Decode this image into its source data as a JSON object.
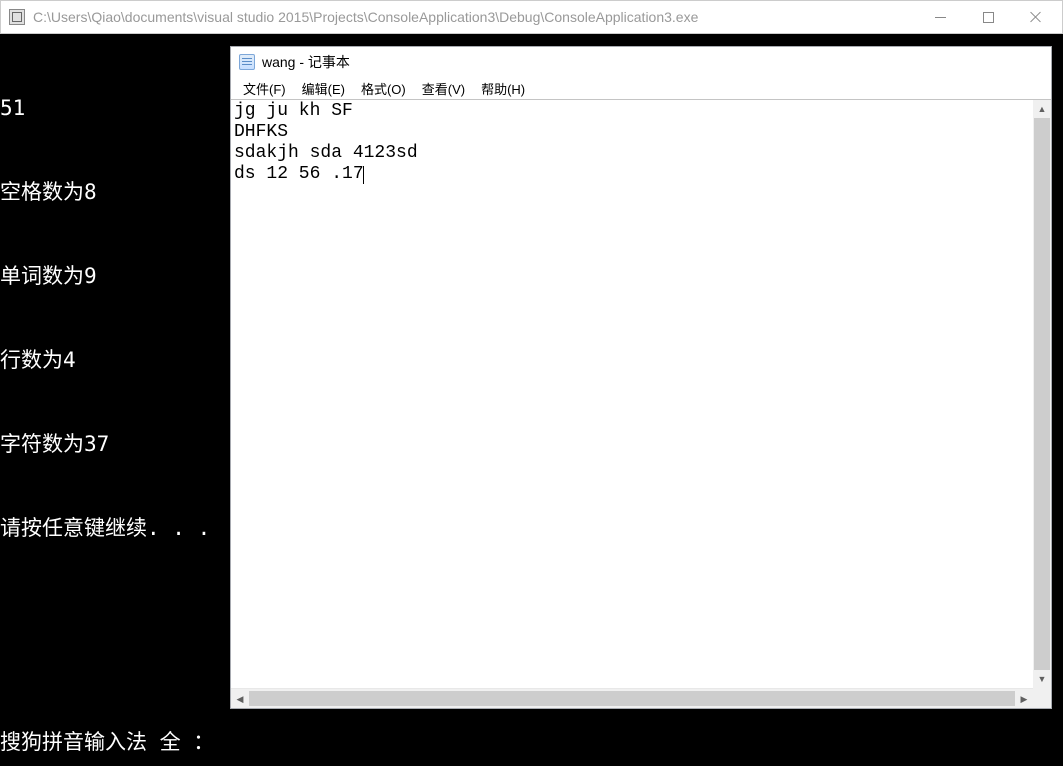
{
  "console_window": {
    "title": "C:\\Users\\Qiao\\documents\\visual studio 2015\\Projects\\ConsoleApplication3\\Debug\\ConsoleApplication3.exe",
    "output_lines": [
      "51",
      "空格数为8",
      "单词数为9",
      "行数为4",
      "字符数为37",
      "请按任意键继续. . ."
    ],
    "ime_status": "搜狗拼音输入法  全 ："
  },
  "notepad": {
    "title": "wang - 记事本",
    "menu": {
      "file": "文件(F)",
      "edit": "编辑(E)",
      "format": "格式(O)",
      "view": "查看(V)",
      "help": "帮助(H)"
    },
    "content_lines": [
      "jg ju kh SF",
      "DHFKS",
      "sdakjh sda 4123sd",
      "ds 12 56 .17"
    ]
  }
}
